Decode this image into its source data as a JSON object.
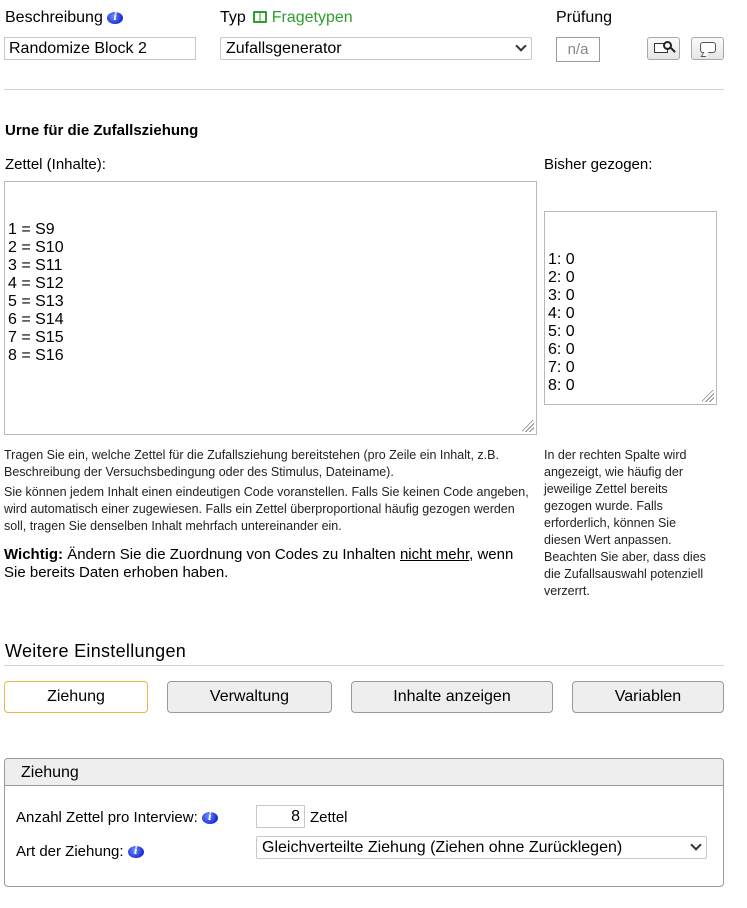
{
  "header": {
    "description_label": "Beschreibung",
    "description_value": "Randomize Block 2",
    "type_label": "Typ",
    "type_link": "Fragetypen",
    "type_value": "Zufallsgenerator",
    "check_label": "Prüfung",
    "check_value": "n/a"
  },
  "urn": {
    "title": "Urne für die Zufallsziehung",
    "slips_label": "Zettel (Inhalte):",
    "slips_text": "1 = S9\n2 = S10\n3 = S11\n4 = S12\n5 = S13\n6 = S14\n7 = S15\n8 = S16",
    "drawn_label": "Bisher gezogen:",
    "drawn_text": "1: 0\n2: 0\n3: 0\n4: 0\n5: 0\n6: 0\n7: 0\n8: 0",
    "help1": "Tragen Sie ein, welche Zettel für die Zufallsziehung bereitstehen (pro Zeile ein Inhalt, z.B. Beschreibung der Versuchsbedingung oder des Stimulus, Dateiname).",
    "help2": "Sie können jedem Inhalt einen eindeutigen Code voranstellen. Falls Sie keinen Code angeben, wird automatisch einer zugewiesen. Falls ein Zettel überproportional häufig gezogen werden soll, tragen Sie denselben Inhalt mehrfach untereinander ein.",
    "warning_bold": "Wichtig:",
    "warning_pre": " Ändern Sie die Zuordnung von Codes zu Inhalten ",
    "warning_underline": "nicht mehr",
    "warning_post": ", wenn Sie bereits Daten erhoben haben.",
    "right_help": "In der rechten Spalte wird angezeigt, wie häufig der jeweilige Zettel bereits gezogen wurde. Falls erforderlich, können Sie diesen Wert anpassen. Beachten Sie aber, dass dies die Zufallsauswahl potenziell verzerrt."
  },
  "settings": {
    "title": "Weitere Einstellungen",
    "tabs": [
      "Ziehung",
      "Verwaltung",
      "Inhalte anzeigen",
      "Variablen"
    ]
  },
  "draw_panel": {
    "title": "Ziehung",
    "count_label": "Anzahl Zettel pro Interview:",
    "count_value": "8",
    "count_unit": "Zettel",
    "mode_label": "Art der Ziehung:",
    "mode_value": "Gleichverteilte Ziehung (Ziehen ohne Zurücklegen)"
  },
  "colors": {
    "link_green": "#2e9e2e",
    "active_tab_border": "#e8b84c",
    "info_blue": "#1a2ed6"
  },
  "icons": [
    "info-icon",
    "book-icon",
    "preview-icon",
    "comment-icon",
    "chevron-down-icon"
  ]
}
